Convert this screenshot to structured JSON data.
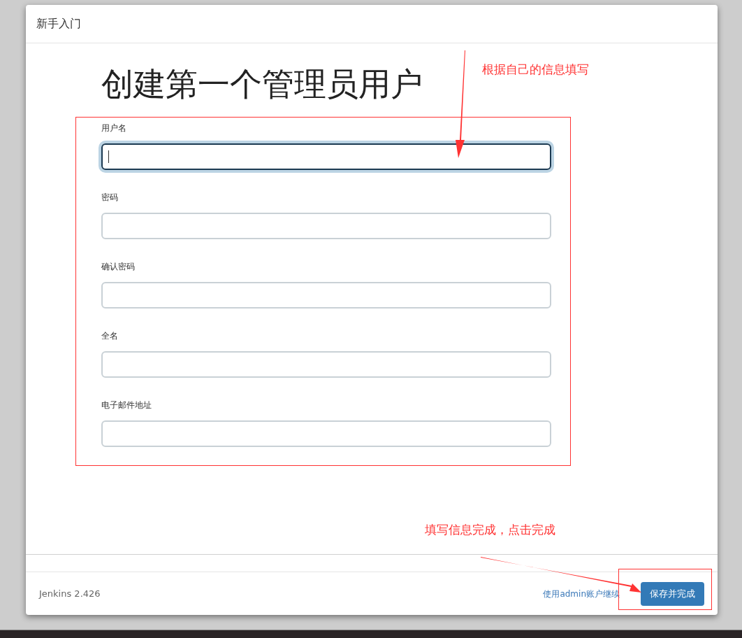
{
  "dialog": {
    "title": "新手入门",
    "heading": "创建第一个管理员用户",
    "fields": [
      {
        "label": "用户名",
        "focused": true
      },
      {
        "label": "密码",
        "focused": false
      },
      {
        "label": "确认密码",
        "focused": false
      },
      {
        "label": "全名",
        "focused": false
      },
      {
        "label": "电子邮件地址",
        "focused": false
      }
    ],
    "version": "Jenkins 2.426",
    "skip_link": "使用admin账户继续",
    "save_button": "保存并完成"
  },
  "annotations": [
    {
      "text": "根据自己的信息填写"
    },
    {
      "text": "填写信息完成，点击完成"
    }
  ]
}
